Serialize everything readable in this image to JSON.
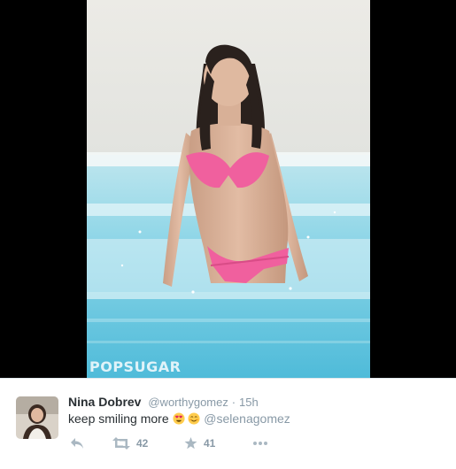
{
  "media": {
    "watermark": "POPSUGAR"
  },
  "tweet": {
    "author_name": "Nina Dobrev",
    "author_handle": "@worthygomez",
    "separator": "·",
    "timestamp": "15h",
    "text": "keep smiling more",
    "emojis": [
      "heart-eyes-emoji",
      "smiling-blush-emoji"
    ],
    "mention": "@selenagomez",
    "actions": {
      "reply_icon": "reply-icon",
      "retweet_icon": "retweet-icon",
      "retweet_count": "42",
      "favorite_icon": "star-icon",
      "favorite_count": "41",
      "more_icon": "more-icon"
    }
  },
  "colors": {
    "name": "#292f33",
    "secondary": "#8899a6",
    "icon": "#aab8c2",
    "bikini": "#f0609e"
  }
}
